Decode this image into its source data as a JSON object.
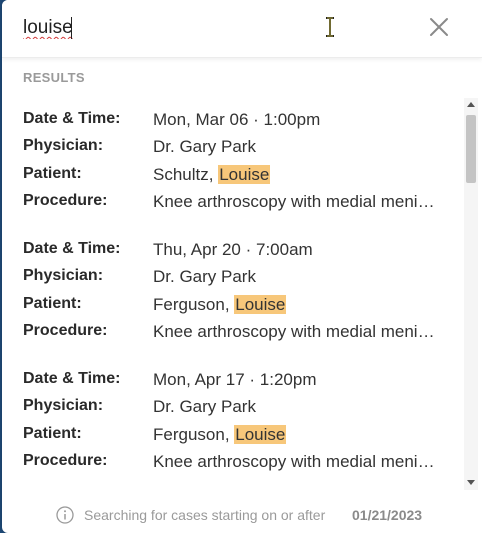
{
  "search": {
    "value": "louise",
    "placeholder": ""
  },
  "results_label": "RESULTS",
  "field_labels": {
    "datetime": "Date & Time:",
    "physician": "Physician:",
    "patient": "Patient:",
    "procedure": "Procedure:"
  },
  "results": [
    {
      "datetime": "Mon, Mar 06 · 1:00pm",
      "physician": "Dr. Gary Park",
      "patient_last": "Schultz, ",
      "patient_first": "Louise",
      "procedure": "Knee arthroscopy with medial meniscectomy"
    },
    {
      "datetime": "Thu, Apr 20 · 7:00am",
      "physician": "Dr. Gary Park",
      "patient_last": "Ferguson, ",
      "patient_first": "Louise",
      "procedure": "Knee arthroscopy with medial meniscectomy"
    },
    {
      "datetime": "Mon, Apr 17 · 1:20pm",
      "physician": "Dr. Gary Park",
      "patient_last": "Ferguson, ",
      "patient_first": "Louise",
      "procedure": "Knee arthroscopy with medial meniscectomy"
    }
  ],
  "footer": {
    "text": "Searching for cases starting on or after",
    "date": "01/21/2023"
  },
  "colors": {
    "highlight": "#f7c77a",
    "backdrop": "#1f4b7a"
  },
  "icons": {
    "close": "close-icon",
    "info": "info-icon",
    "cursor": "text-cursor-icon"
  }
}
